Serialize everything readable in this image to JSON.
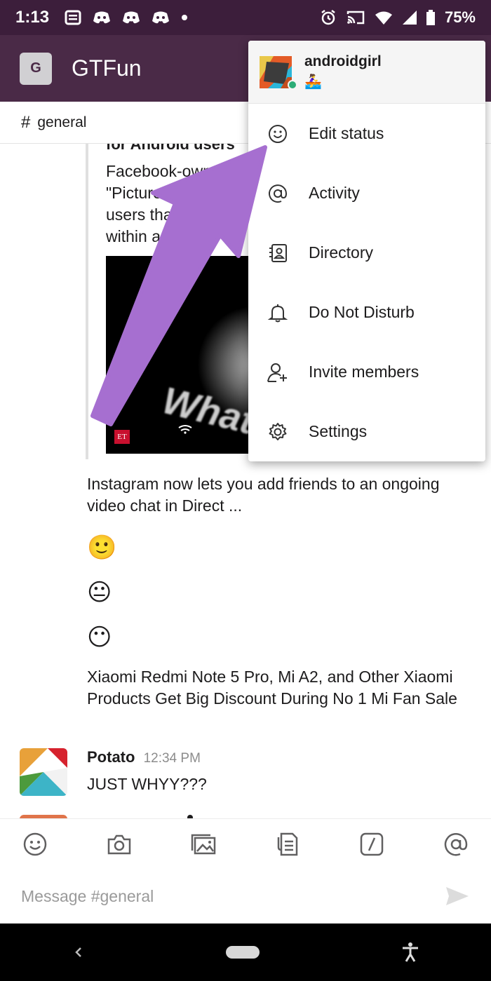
{
  "status_bar": {
    "time": "1:13",
    "battery": "75%",
    "notification_icons": [
      "newsletter-icon",
      "discord-icon",
      "discord-icon",
      "discord-icon",
      "dot-icon"
    ],
    "system_icons": [
      "alarm-icon",
      "cast-icon",
      "wifi-icon",
      "signal-icon",
      "battery-icon"
    ]
  },
  "app_bar": {
    "workspace_initial": "G",
    "workspace_name": "GTFun"
  },
  "channel": {
    "hash": "#",
    "name": "general"
  },
  "feed": {
    "clipped_title": "for Android users",
    "clipped_body": [
      "Facebook-own",
      "\"Picture in",
      "users that v",
      "within a ch"
    ],
    "preview_text": "What",
    "preview_logo": "ET",
    "instagram_text": "Instagram now lets you add friends to an ongoing video chat in Direct ...",
    "emojis": [
      "🙂",
      "😐",
      "😶"
    ],
    "xiaomi_text": "Xiaomi Redmi Note 5 Pro, Mi A2, and Other Xiaomi Products Get Big Discount During No 1 Mi Fan Sale",
    "message": {
      "author": "Potato",
      "timestamp": "12:34 PM",
      "text": "JUST WHYY???"
    }
  },
  "toolbar": {
    "icons": [
      "emoji-icon",
      "camera-icon",
      "gallery-icon",
      "file-icon",
      "slash-command-icon",
      "mention-icon"
    ]
  },
  "composer": {
    "placeholder": "Message #general",
    "value": ""
  },
  "menu": {
    "username": "androidgirl",
    "status_emoji": "🚣‍♀️",
    "items": [
      {
        "label": "Edit status",
        "icon": "smiley-icon"
      },
      {
        "label": "Activity",
        "icon": "at-icon"
      },
      {
        "label": "Directory",
        "icon": "directory-icon"
      },
      {
        "label": "Do Not Disturb",
        "icon": "bell-icon"
      },
      {
        "label": "Invite members",
        "icon": "add-person-icon"
      },
      {
        "label": "Settings",
        "icon": "gear-icon"
      }
    ]
  },
  "colors": {
    "status_bar": "#3c1e3b",
    "app_bar": "#4a2a47",
    "arrow": "#a66fd0",
    "online": "#2bac76"
  }
}
